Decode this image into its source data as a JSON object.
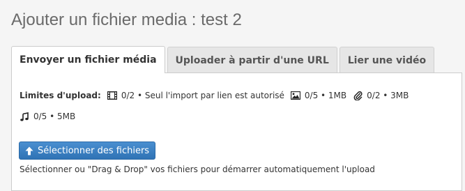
{
  "title": "Ajouter un fichier media : test 2",
  "tabs": [
    {
      "label": "Envoyer un fichier média",
      "active": true
    },
    {
      "label": "Uploader à partir d'une URL",
      "active": false
    },
    {
      "label": "Lier une vidéo",
      "active": false
    }
  ],
  "limits": {
    "label": "Limites d'upload:",
    "video": {
      "icon": "film-icon",
      "text": "0/2 • Seul l'import par lien est autorisé"
    },
    "image": {
      "icon": "picture-icon",
      "text": "0/5 • 1MB"
    },
    "document": {
      "icon": "paperclip-icon",
      "text": "0/2 • 3MB"
    },
    "audio": {
      "icon": "music-note-icon",
      "text": "0/5 • 5MB"
    }
  },
  "upload_button": {
    "icon": "arrow-up-icon",
    "label": "Sélectionner des fichiers"
  },
  "hint": "Sélectionner ou \"Drag & Drop\" vos fichiers pour démarrer automatiquement l'upload",
  "colors": {
    "accent": "#3a7fc1",
    "background": "#f5f5f5",
    "panel": "#ffffff",
    "tab_inactive": "#e6e6e6"
  }
}
